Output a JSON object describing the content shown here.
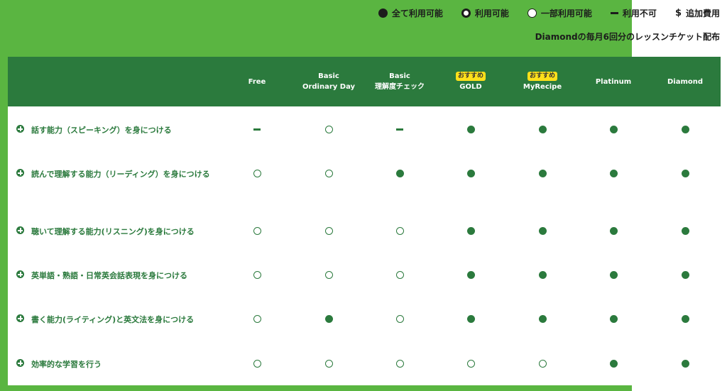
{
  "legend": [
    {
      "icon": "filled-circle-icon",
      "label": "全て利用可能"
    },
    {
      "icon": "target-circle-icon",
      "label": "利用可能"
    },
    {
      "icon": "open-circle-icon",
      "label": "一部利用可能"
    },
    {
      "icon": "dash-icon",
      "label": "利用不可"
    },
    {
      "icon": "dollar-icon",
      "label": "追加費用"
    }
  ],
  "note": "Diamondの毎月6回分のレッスンチケット配布",
  "plans": [
    {
      "badge": "",
      "lines": [
        "Free"
      ]
    },
    {
      "badge": "",
      "lines": [
        "Basic",
        "Ordinary Day"
      ]
    },
    {
      "badge": "",
      "lines": [
        "Basic",
        "理解度チェック"
      ]
    },
    {
      "badge": "おすすめ",
      "lines": [
        "GOLD"
      ]
    },
    {
      "badge": "おすすめ",
      "lines": [
        "MyRecipe"
      ]
    },
    {
      "badge": "",
      "lines": [
        "Platinum"
      ]
    },
    {
      "badge": "",
      "lines": [
        "Diamond"
      ]
    }
  ],
  "rows": [
    {
      "label": "話す能力（スピーキング）を身につける",
      "values": [
        "none",
        "partial",
        "none",
        "full",
        "full",
        "full",
        "full"
      ]
    },
    {
      "label": "読んで理解する能力（リーディング）を身につける",
      "values": [
        "partial",
        "partial",
        "full",
        "full",
        "full",
        "full",
        "full"
      ]
    },
    {
      "label": "聴いて理解する能力(リスニング)を身につける",
      "values": [
        "partial",
        "partial",
        "partial",
        "full",
        "full",
        "full",
        "full"
      ]
    },
    {
      "label": "英単語・熟語・日常英会話表現を身につける",
      "values": [
        "partial",
        "partial",
        "partial",
        "full",
        "full",
        "full",
        "full"
      ]
    },
    {
      "label": "書く能力(ライティング)と英文法を身につける",
      "values": [
        "partial",
        "full",
        "partial",
        "full",
        "full",
        "full",
        "full"
      ]
    },
    {
      "label": "効率的な学習を行う",
      "values": [
        "partial",
        "partial",
        "partial",
        "partial",
        "partial",
        "full",
        "full"
      ]
    }
  ],
  "colors": {
    "accent": "#2b7a3d",
    "background": "#5ab541",
    "badge": "#ffe01a"
  }
}
